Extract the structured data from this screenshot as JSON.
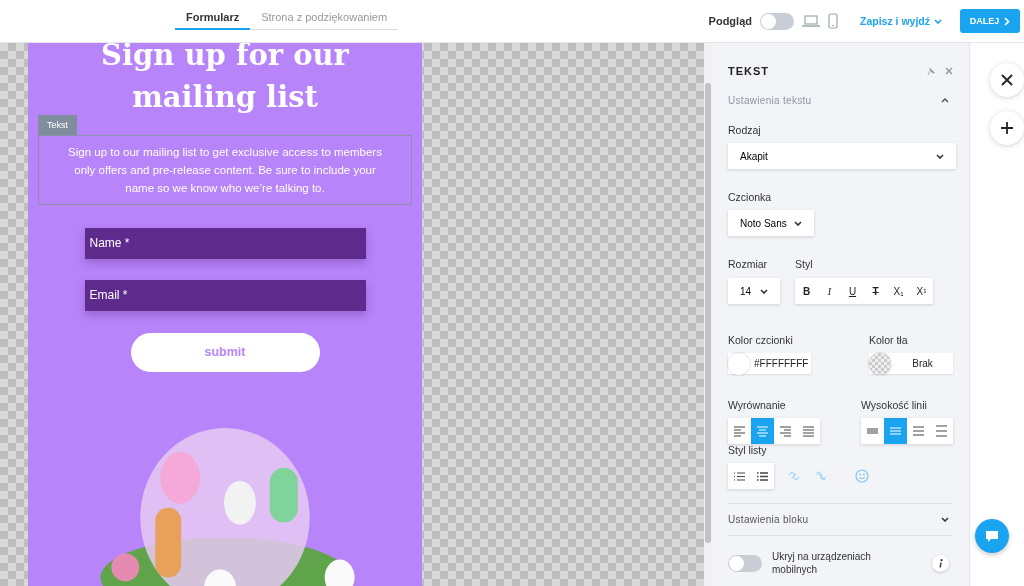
{
  "top_tabs": [
    {
      "label": "Formularz",
      "selected": true
    },
    {
      "label": "Strona z podziękowaniem",
      "selected": false
    }
  ],
  "toolbar": {
    "preview_label": "Podgląd",
    "preview_on": false,
    "save_label": "Zapisz i wyjdź",
    "next_label": "DALEJ"
  },
  "form": {
    "heading": "Sign up for our mailing list",
    "selection_label": "Tekst",
    "paragraph": "Sign up to our mailing list to get exclusive access to members only offers and pre-release content. Be sure to include your name so we know who we’re talking to.",
    "fields": [
      {
        "placeholder": "Name *"
      },
      {
        "placeholder": "Email *"
      }
    ],
    "submit": "submit"
  },
  "panel": {
    "title": "TEKST",
    "text_section": {
      "label": "Ustawienia tekstu",
      "expanded": true
    },
    "type": {
      "label": "Rodzaj",
      "value": "Akapit"
    },
    "font": {
      "label": "Czcionka",
      "value": "Noto Sans"
    },
    "size": {
      "label": "Rozmiar",
      "value": "14"
    },
    "style": {
      "label": "Styl",
      "buttons": [
        {
          "kind": "bold",
          "label": "B"
        },
        {
          "kind": "italic",
          "label": "I"
        },
        {
          "kind": "underline",
          "label": "U"
        },
        {
          "kind": "strike",
          "label": "T"
        },
        {
          "kind": "sub",
          "label": "X₁"
        },
        {
          "kind": "sup",
          "label": "X¹"
        }
      ]
    },
    "font_color": {
      "label": "Kolor czcionki",
      "value": "#FFFFFFFF"
    },
    "bg_color": {
      "label": "Kolor tła",
      "value": "Brak"
    },
    "alignment": {
      "label": "Wyrównanie",
      "options": [
        {
          "kind": "left",
          "selected": false
        },
        {
          "kind": "center",
          "selected": true
        },
        {
          "kind": "right",
          "selected": false
        },
        {
          "kind": "justify",
          "selected": false
        }
      ]
    },
    "line_height": {
      "label": "Wysokość linii",
      "options": [
        {
          "kind": "compact",
          "selected": false
        },
        {
          "kind": "normal",
          "selected": true
        },
        {
          "kind": "wide",
          "selected": false
        },
        {
          "kind": "widest",
          "selected": false
        }
      ]
    },
    "list_style": {
      "label": "Styl listy"
    },
    "block_section": {
      "label": "Ustawienia bloku",
      "expanded": false
    },
    "hide_mobile": {
      "label": "Ukryj na urządzeniach mobilnych",
      "on": false
    }
  }
}
